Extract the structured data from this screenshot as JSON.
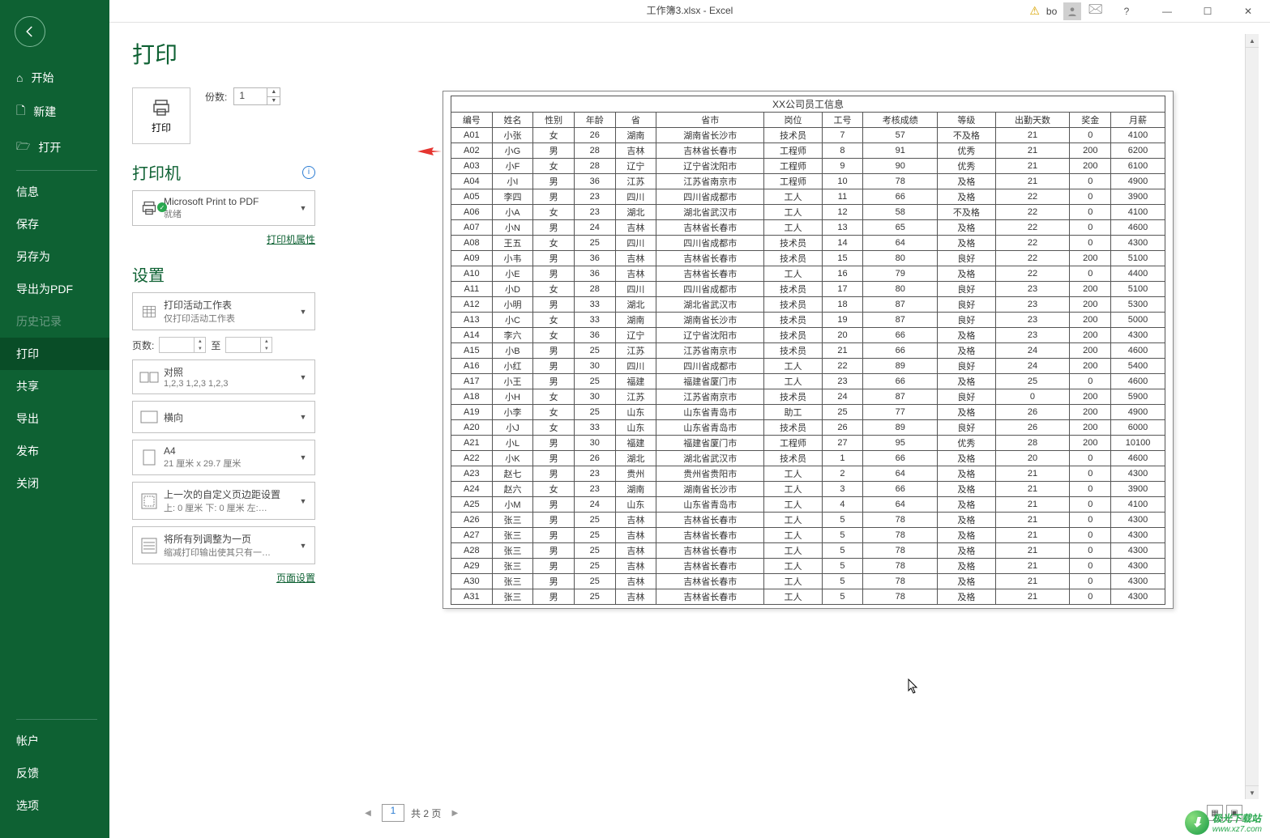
{
  "titlebar": {
    "title": "工作簿3.xlsx  -  Excel",
    "user": "bo"
  },
  "sidebar": {
    "start": "开始",
    "new": "新建",
    "open": "打开",
    "info": "信息",
    "save": "保存",
    "saveas": "另存为",
    "export_pdf": "导出为PDF",
    "history": "历史记录",
    "print": "打印",
    "share": "共享",
    "export": "导出",
    "publish": "发布",
    "close": "关闭",
    "account": "帐户",
    "feedback": "反馈",
    "options": "选项"
  },
  "print": {
    "heading": "打印",
    "copies_label": "份数:",
    "copies": "1",
    "print_btn": "打印"
  },
  "printer": {
    "heading": "打印机",
    "name": "Microsoft Print to PDF",
    "status": "就绪",
    "properties": "打印机属性"
  },
  "settings": {
    "heading": "设置",
    "what": {
      "t1": "打印活动工作表",
      "t2": "仅打印活动工作表"
    },
    "pages_label": "页数:",
    "to": "至",
    "collate": {
      "t1": "对照",
      "t2": "1,2,3    1,2,3    1,2,3"
    },
    "orient": {
      "t1": "横向"
    },
    "paper": {
      "t1": "A4",
      "t2": "21 厘米 x 29.7 厘米"
    },
    "margins": {
      "t1": "上一次的自定义页边距设置",
      "t2": "上: 0 厘米 下: 0 厘米 左:…"
    },
    "scale": {
      "t1": "将所有列调整为一页",
      "t2": "缩减打印输出使其只有一…"
    },
    "page_setup": "页面设置"
  },
  "nav": {
    "current": "1",
    "total": "共 2 页"
  },
  "watermark": {
    "text": "极光下载站",
    "url": "www.xz7.com"
  },
  "chart_data": {
    "type": "table",
    "title": "XX公司员工信息",
    "columns": [
      "编号",
      "姓名",
      "性别",
      "年龄",
      "省",
      "省市",
      "岗位",
      "工号",
      "考核成绩",
      "等级",
      "出勤天数",
      "奖金",
      "月薪"
    ],
    "rows": [
      [
        "A01",
        "小张",
        "女",
        "26",
        "湖南",
        "湖南省长沙市",
        "技术员",
        "7",
        "57",
        "不及格",
        "21",
        "0",
        "4100"
      ],
      [
        "A02",
        "小G",
        "男",
        "28",
        "吉林",
        "吉林省长春市",
        "工程师",
        "8",
        "91",
        "优秀",
        "21",
        "200",
        "6200"
      ],
      [
        "A03",
        "小F",
        "女",
        "28",
        "辽宁",
        "辽宁省沈阳市",
        "工程师",
        "9",
        "90",
        "优秀",
        "21",
        "200",
        "6100"
      ],
      [
        "A04",
        "小I",
        "男",
        "36",
        "江苏",
        "江苏省南京市",
        "工程师",
        "10",
        "78",
        "及格",
        "21",
        "0",
        "4900"
      ],
      [
        "A05",
        "李四",
        "男",
        "23",
        "四川",
        "四川省成都市",
        "工人",
        "11",
        "66",
        "及格",
        "22",
        "0",
        "3900"
      ],
      [
        "A06",
        "小A",
        "女",
        "23",
        "湖北",
        "湖北省武汉市",
        "工人",
        "12",
        "58",
        "不及格",
        "22",
        "0",
        "4100"
      ],
      [
        "A07",
        "小N",
        "男",
        "24",
        "吉林",
        "吉林省长春市",
        "工人",
        "13",
        "65",
        "及格",
        "22",
        "0",
        "4600"
      ],
      [
        "A08",
        "王五",
        "女",
        "25",
        "四川",
        "四川省成都市",
        "技术员",
        "14",
        "64",
        "及格",
        "22",
        "0",
        "4300"
      ],
      [
        "A09",
        "小韦",
        "男",
        "36",
        "吉林",
        "吉林省长春市",
        "技术员",
        "15",
        "80",
        "良好",
        "22",
        "200",
        "5100"
      ],
      [
        "A10",
        "小E",
        "男",
        "36",
        "吉林",
        "吉林省长春市",
        "工人",
        "16",
        "79",
        "及格",
        "22",
        "0",
        "4400"
      ],
      [
        "A11",
        "小D",
        "女",
        "28",
        "四川",
        "四川省成都市",
        "技术员",
        "17",
        "80",
        "良好",
        "23",
        "200",
        "5100"
      ],
      [
        "A12",
        "小明",
        "男",
        "33",
        "湖北",
        "湖北省武汉市",
        "技术员",
        "18",
        "87",
        "良好",
        "23",
        "200",
        "5300"
      ],
      [
        "A13",
        "小C",
        "女",
        "33",
        "湖南",
        "湖南省长沙市",
        "技术员",
        "19",
        "87",
        "良好",
        "23",
        "200",
        "5000"
      ],
      [
        "A14",
        "李六",
        "女",
        "36",
        "辽宁",
        "辽宁省沈阳市",
        "技术员",
        "20",
        "66",
        "及格",
        "23",
        "200",
        "4300"
      ],
      [
        "A15",
        "小B",
        "男",
        "25",
        "江苏",
        "江苏省南京市",
        "技术员",
        "21",
        "66",
        "及格",
        "24",
        "200",
        "4600"
      ],
      [
        "A16",
        "小红",
        "男",
        "30",
        "四川",
        "四川省成都市",
        "工人",
        "22",
        "89",
        "良好",
        "24",
        "200",
        "5400"
      ],
      [
        "A17",
        "小王",
        "男",
        "25",
        "福建",
        "福建省厦门市",
        "工人",
        "23",
        "66",
        "及格",
        "25",
        "0",
        "4600"
      ],
      [
        "A18",
        "小H",
        "女",
        "30",
        "江苏",
        "江苏省南京市",
        "技术员",
        "24",
        "87",
        "良好",
        "0",
        "200",
        "5900"
      ],
      [
        "A19",
        "小李",
        "女",
        "25",
        "山东",
        "山东省青岛市",
        "助工",
        "25",
        "77",
        "及格",
        "26",
        "200",
        "4900"
      ],
      [
        "A20",
        "小J",
        "女",
        "33",
        "山东",
        "山东省青岛市",
        "技术员",
        "26",
        "89",
        "良好",
        "26",
        "200",
        "6000"
      ],
      [
        "A21",
        "小L",
        "男",
        "30",
        "福建",
        "福建省厦门市",
        "工程师",
        "27",
        "95",
        "优秀",
        "28",
        "200",
        "10100"
      ],
      [
        "A22",
        "小K",
        "男",
        "26",
        "湖北",
        "湖北省武汉市",
        "技术员",
        "1",
        "66",
        "及格",
        "20",
        "0",
        "4600"
      ],
      [
        "A23",
        "赵七",
        "男",
        "23",
        "贵州",
        "贵州省贵阳市",
        "工人",
        "2",
        "64",
        "及格",
        "21",
        "0",
        "4300"
      ],
      [
        "A24",
        "赵六",
        "女",
        "23",
        "湖南",
        "湖南省长沙市",
        "工人",
        "3",
        "66",
        "及格",
        "21",
        "0",
        "3900"
      ],
      [
        "A25",
        "小M",
        "男",
        "24",
        "山东",
        "山东省青岛市",
        "工人",
        "4",
        "64",
        "及格",
        "21",
        "0",
        "4100"
      ],
      [
        "A26",
        "张三",
        "男",
        "25",
        "吉林",
        "吉林省长春市",
        "工人",
        "5",
        "78",
        "及格",
        "21",
        "0",
        "4300"
      ],
      [
        "A27",
        "张三",
        "男",
        "25",
        "吉林",
        "吉林省长春市",
        "工人",
        "5",
        "78",
        "及格",
        "21",
        "0",
        "4300"
      ],
      [
        "A28",
        "张三",
        "男",
        "25",
        "吉林",
        "吉林省长春市",
        "工人",
        "5",
        "78",
        "及格",
        "21",
        "0",
        "4300"
      ],
      [
        "A29",
        "张三",
        "男",
        "25",
        "吉林",
        "吉林省长春市",
        "工人",
        "5",
        "78",
        "及格",
        "21",
        "0",
        "4300"
      ],
      [
        "A30",
        "张三",
        "男",
        "25",
        "吉林",
        "吉林省长春市",
        "工人",
        "5",
        "78",
        "及格",
        "21",
        "0",
        "4300"
      ],
      [
        "A31",
        "张三",
        "男",
        "25",
        "吉林",
        "吉林省长春市",
        "工人",
        "5",
        "78",
        "及格",
        "21",
        "0",
        "4300"
      ]
    ]
  }
}
